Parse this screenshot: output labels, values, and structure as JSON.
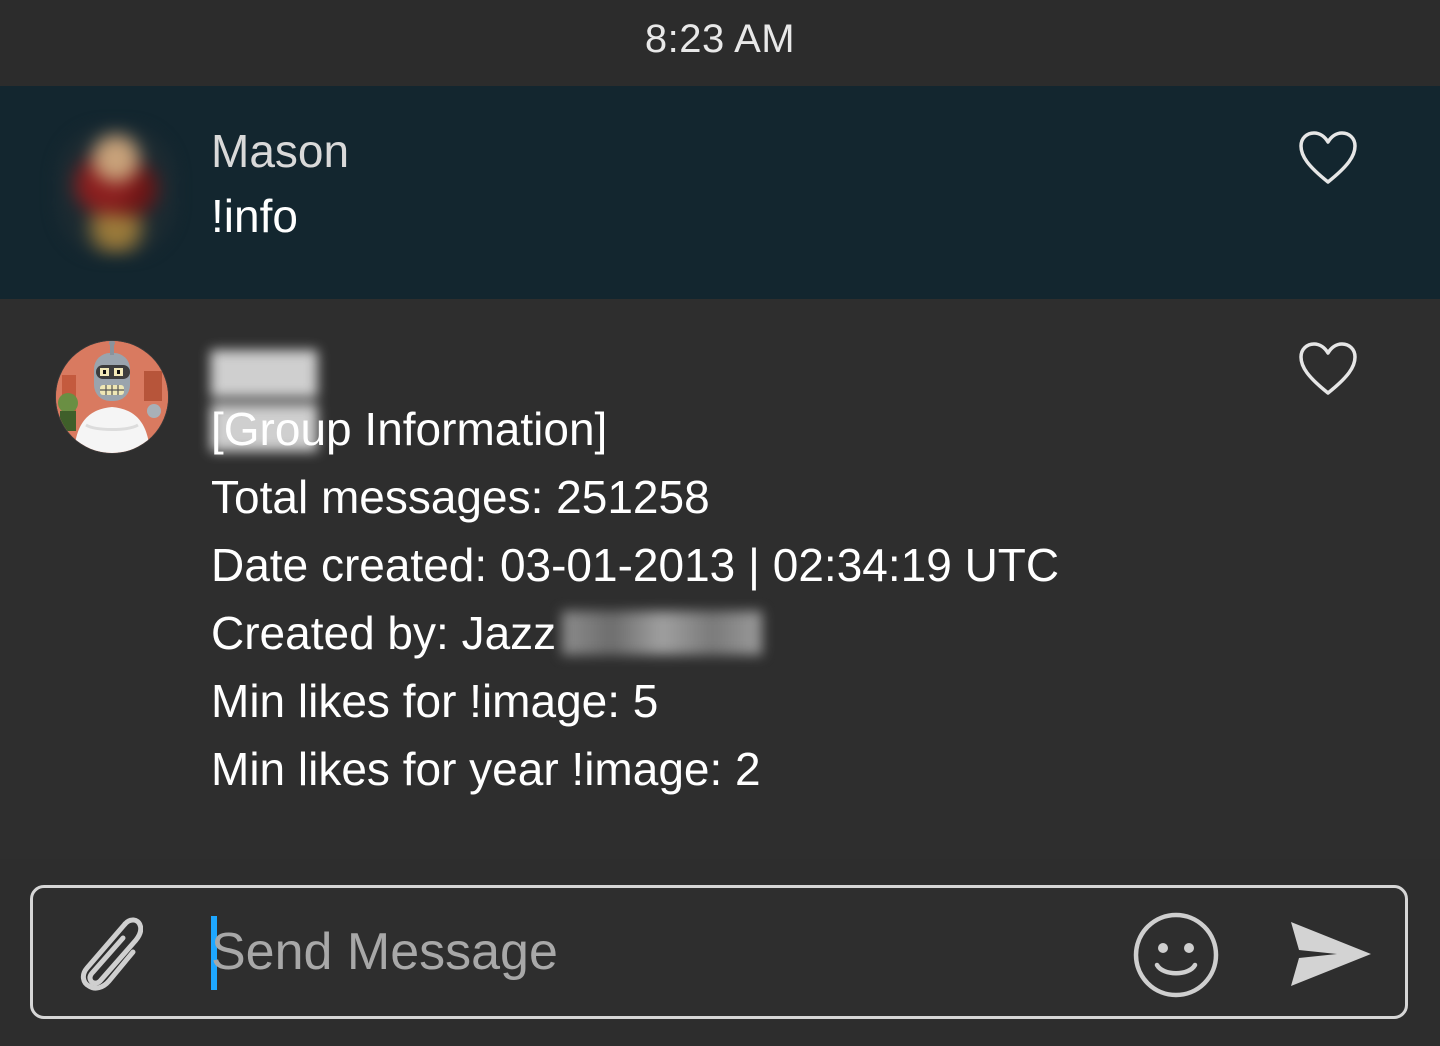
{
  "status_bar": {
    "time": "8:23 AM"
  },
  "messages": [
    {
      "author": "Mason",
      "text": "!info",
      "highlighted": true,
      "avatar_icon": "blurred-avatar",
      "like_icon": "heart-outline-icon"
    },
    {
      "author_blurred": true,
      "avatar_icon": "bender-avatar",
      "like_icon": "heart-outline-icon",
      "lines": [
        "[Group Information]",
        "Total messages: 251258",
        "Date created: 03-01-2013 | 02:34:19 UTC",
        "Created by: Jazz",
        "Min likes for !image: 5",
        "Min likes for year !image: 2"
      ]
    }
  ],
  "composer": {
    "placeholder": "Send Message",
    "value": "",
    "attach_icon": "paperclip-icon",
    "emoji_icon": "smiley-icon",
    "send_icon": "send-arrow-icon"
  },
  "colors": {
    "background": "#2d2d2d",
    "highlight_background": "#13262f",
    "caret": "#1ea7ff",
    "text": "#ffffff",
    "muted_text": "#d9d9d9"
  }
}
